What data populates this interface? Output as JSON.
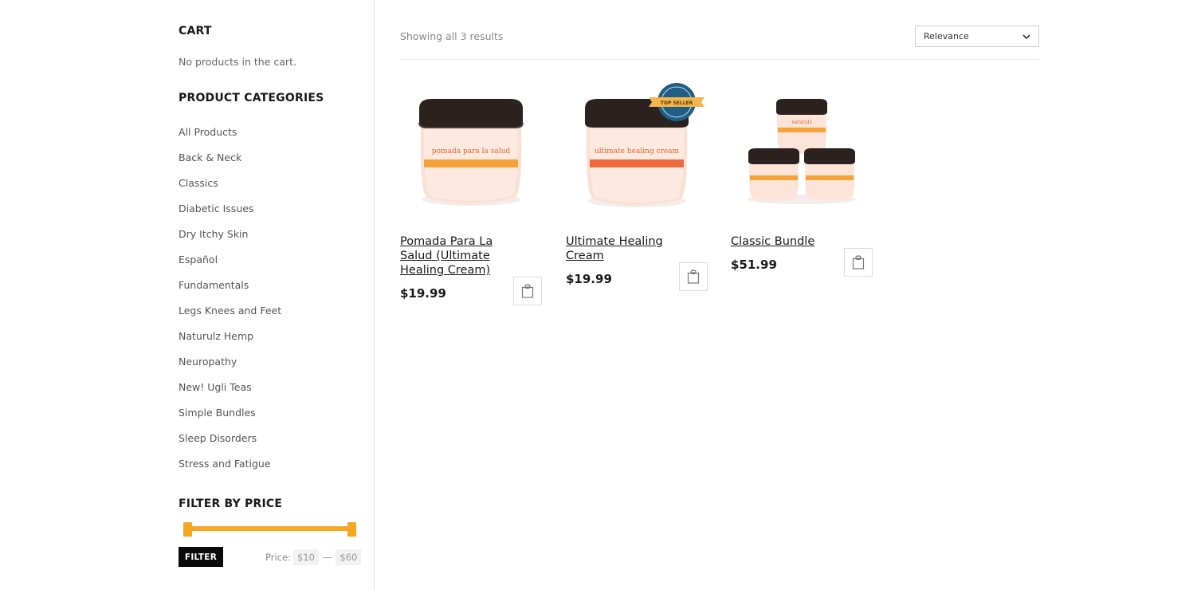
{
  "sidebar": {
    "cart_title": "CART",
    "cart_empty": "No products in the cart.",
    "categories_title": "PRODUCT CATEGORIES",
    "categories": [
      "All Products",
      "Back & Neck",
      "Classics",
      "Diabetic Issues",
      "Dry Itchy Skin",
      "Español",
      "Fundamentals",
      "Legs Knees and Feet",
      "Naturulz Hemp",
      "Neuropathy",
      "New! Ugli Teas",
      "Simple Bundles",
      "Sleep Disorders",
      "Stress and Fatigue"
    ],
    "price_filter": {
      "title": "FILTER BY PRICE",
      "button_label": "FILTER",
      "price_label": "Price:",
      "min": "$10",
      "max": "$60",
      "dash": "—",
      "accent_color": "#f5a623"
    }
  },
  "main": {
    "result_count": "Showing all 3 results",
    "sort": {
      "selected": "Relevance"
    },
    "products": [
      {
        "name": "Pomada Para La Salud (Ultimate Healing Cream)",
        "price": "$19.99",
        "jar_label": "pomada para la salud",
        "badge": ""
      },
      {
        "name": "Ultimate Healing Cream",
        "price": "$19.99",
        "jar_label": "ultimate healing cream",
        "badge": "TOP SELLER"
      },
      {
        "name": "Classic Bundle",
        "price": "$51.99",
        "jar_label": "naturulz",
        "badge": ""
      }
    ]
  }
}
